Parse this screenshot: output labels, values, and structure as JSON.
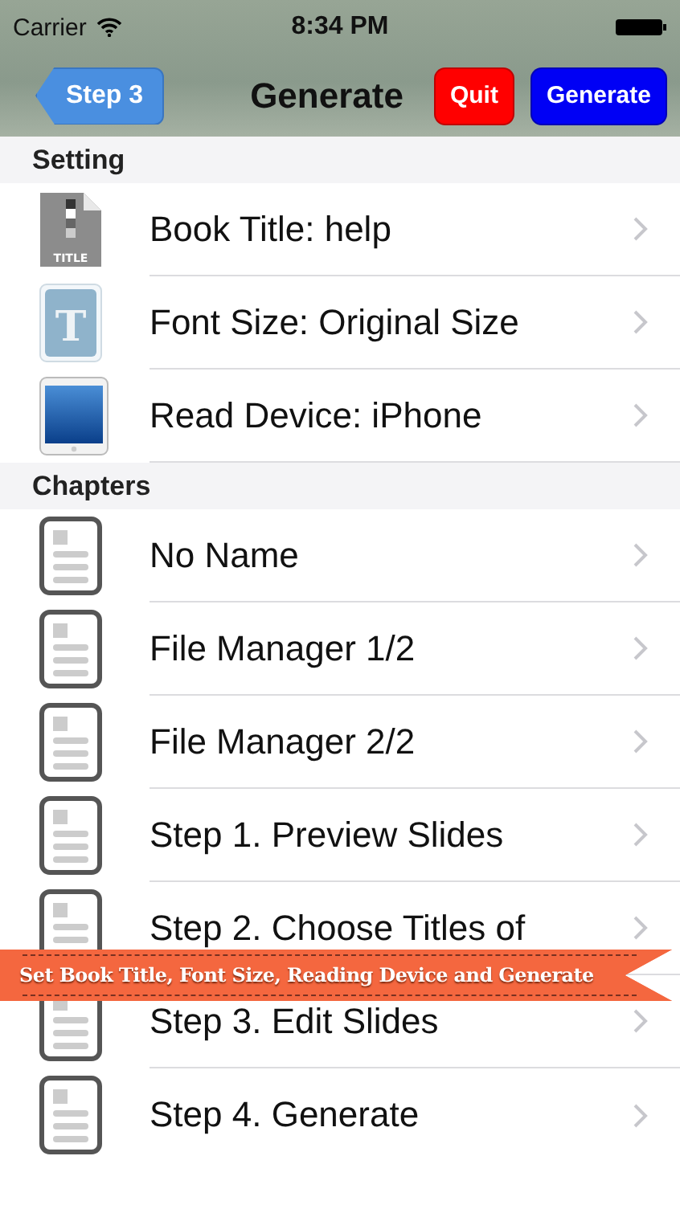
{
  "status_bar": {
    "carrier": "Carrier",
    "time": "8:34 PM"
  },
  "nav": {
    "back": "Step 3",
    "title": "Generate",
    "buttons": [
      {
        "label": "Quit",
        "color": "#ff0000"
      },
      {
        "label": "Generate",
        "color": "#0000f5"
      }
    ]
  },
  "sections": [
    {
      "header": "Setting",
      "items": [
        {
          "kind": "title",
          "label": "Book Title: help",
          "icon_text": "TITLE"
        },
        {
          "kind": "font",
          "label": "Font Size: Original Size",
          "icon_text": "T"
        },
        {
          "kind": "device",
          "label": "Read Device: iPhone"
        }
      ]
    },
    {
      "header": "Chapters",
      "items": [
        {
          "kind": "doc",
          "label": "No Name"
        },
        {
          "kind": "doc",
          "label": "File Manager 1/2"
        },
        {
          "kind": "doc",
          "label": "File Manager 2/2"
        },
        {
          "kind": "doc",
          "label": "Step 1. Preview Slides"
        },
        {
          "kind": "doc",
          "label": "Step 2. Choose Titles of"
        },
        {
          "kind": "doc",
          "label": "Step 3. Edit Slides"
        },
        {
          "kind": "doc",
          "label": "Step 4. Generate"
        }
      ]
    }
  ],
  "banner": {
    "text": "Set Book Title, Font Size, Reading Device and Generate"
  }
}
